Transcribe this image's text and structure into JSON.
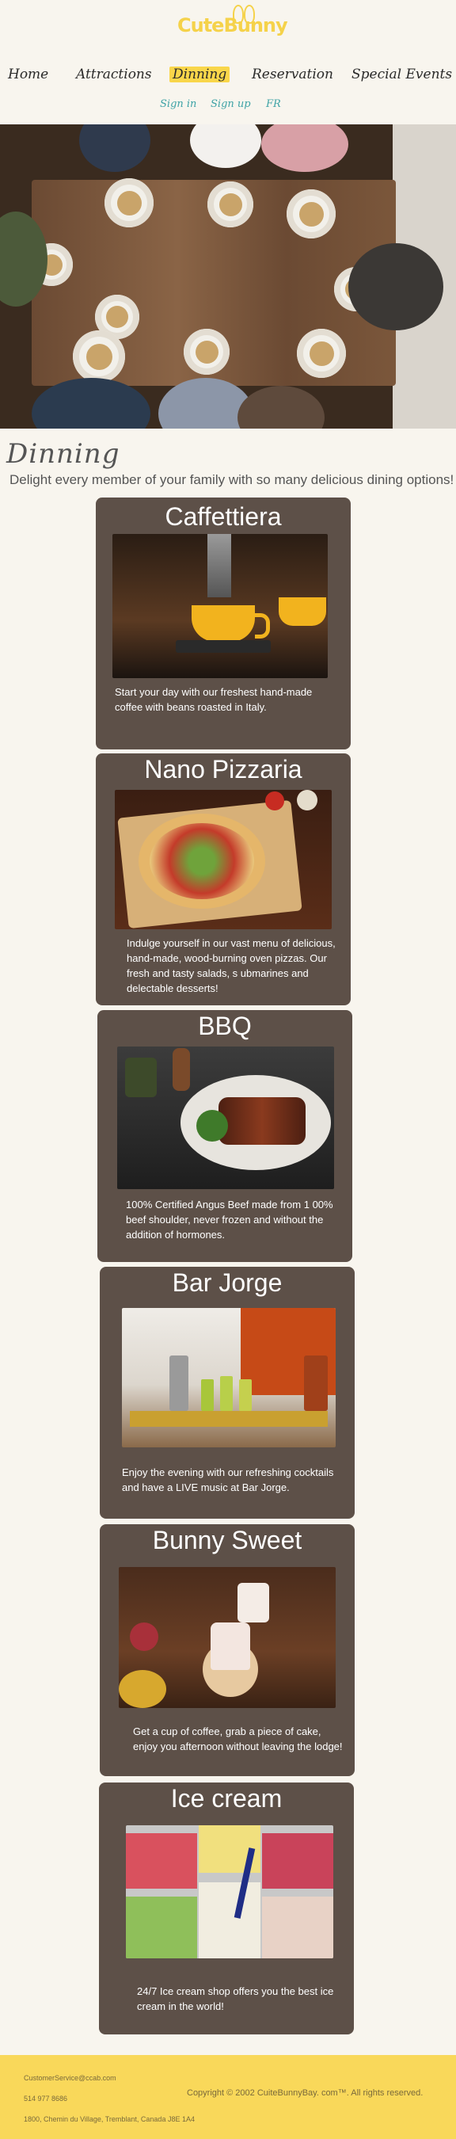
{
  "header": {
    "logo_text": "CuteBunny",
    "nav": [
      "Home",
      "Attractions",
      "Dinning",
      "Reservation",
      "Special Events"
    ],
    "subnav": [
      "Sign in",
      "Sign up",
      "FR"
    ]
  },
  "page": {
    "title": "Dinning",
    "subtitle": "Delight every member of your family with so many delicious dining options!"
  },
  "cards": [
    {
      "title": "Caffettiera",
      "text": "Start your day with our freshest hand-made coffee with beans roasted in Italy."
    },
    {
      "title": "Nano Pizzaria",
      "text": "Indulge yourself in our vast menu of delicious, hand-made, wood-burning oven pizzas. Our fresh and tasty salads, s ubmarines and delectable desserts!"
    },
    {
      "title": "BBQ",
      "text": "100% Certified Angus Beef made from 1 00% beef shoulder, never frozen and without the addition of hormones."
    },
    {
      "title": "Bar Jorge",
      "text": "Enjoy the evening with our refreshing cocktails and have a LIVE music at Bar Jorge."
    },
    {
      "title": "Bunny Sweet",
      "text": "Get a cup of coffee, grab a piece of cake, enjoy you afternoon without leaving the lodge!"
    },
    {
      "title": "Ice cream",
      "text": "24/7 Ice cream shop offers you the best ice cream in the world!"
    }
  ],
  "footer": {
    "email": "CustomerService@ccab.com",
    "phone": "514 977 8686",
    "address": "1800, Chemin du Village, Tremblant, Canada J8E 1A4",
    "copyright": "Copyright © 2002 CuiteBunnyBay. com™. All rights reserved."
  },
  "colors": {
    "accent": "#f9d64a",
    "card": "#5d5048",
    "link": "#3fa3a6",
    "background": "#f8f5ee"
  }
}
